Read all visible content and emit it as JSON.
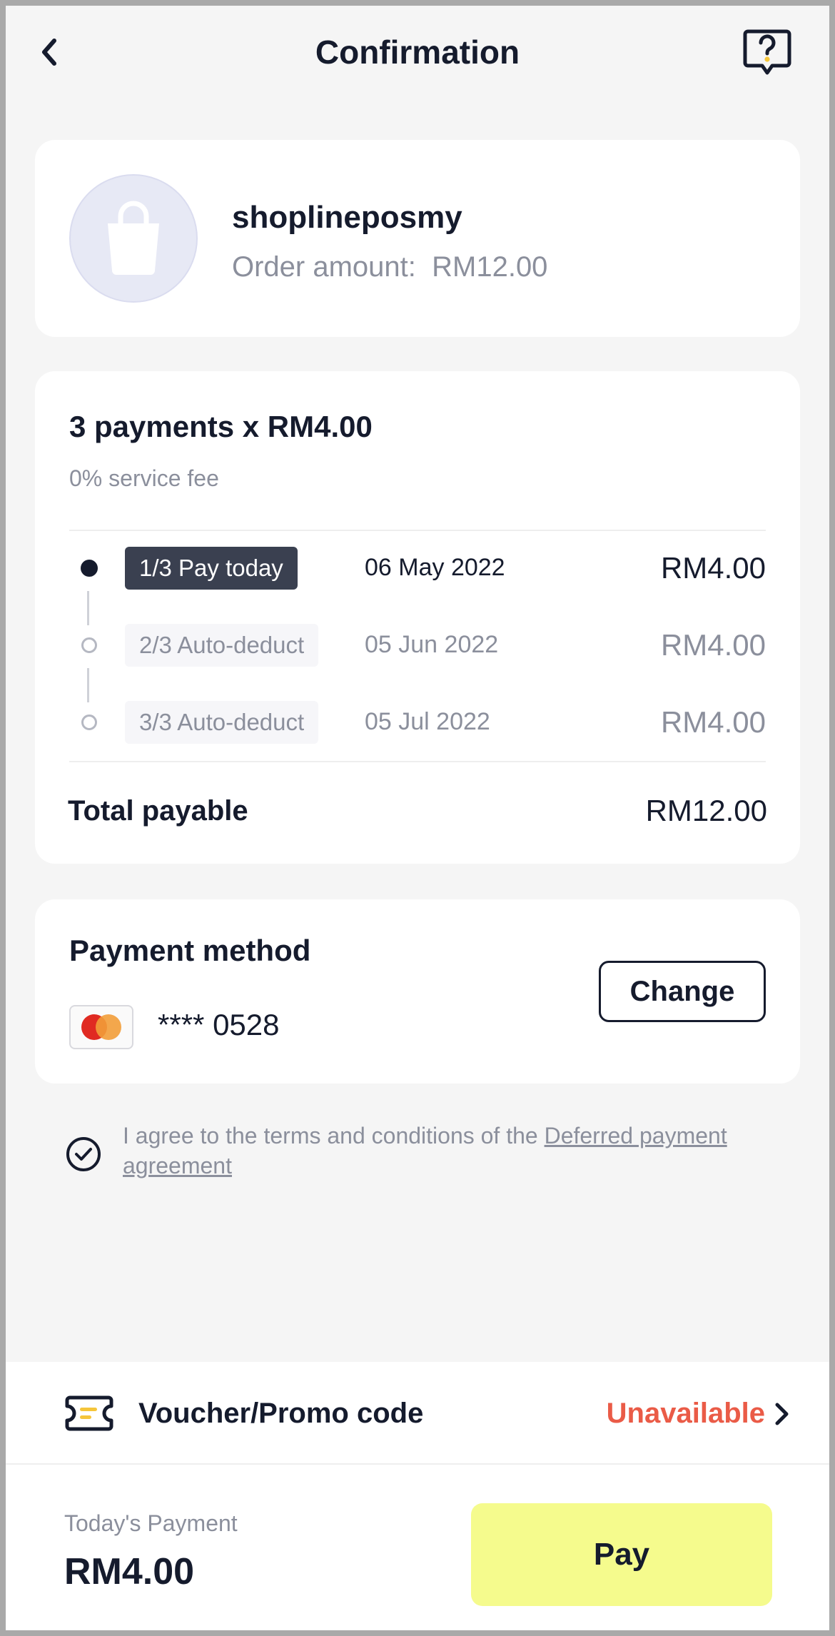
{
  "header": {
    "title": "Confirmation",
    "back_icon": "chevron-left-icon",
    "help_icon": "help-chat-icon"
  },
  "merchant": {
    "name": "shoplineposmy",
    "order_amount_label": "Order amount:",
    "order_amount": "RM12.00",
    "logo_icon": "shopping-bag-icon"
  },
  "plan": {
    "title": "3 payments x RM4.00",
    "fee": "0% service fee",
    "installments": [
      {
        "badge": "1/3 Pay today",
        "date": "06 May 2022",
        "amount": "RM4.00",
        "status": "active"
      },
      {
        "badge": "2/3 Auto-deduct",
        "date": "05 Jun 2022",
        "amount": "RM4.00",
        "status": "pending"
      },
      {
        "badge": "3/3 Auto-deduct",
        "date": "05 Jul 2022",
        "amount": "RM4.00",
        "status": "pending"
      }
    ],
    "total_label": "Total payable",
    "total_value": "RM12.00"
  },
  "payment_method": {
    "title": "Payment method",
    "card_brand_icon": "mastercard-icon",
    "card_masked": "****",
    "card_last4": "0528",
    "change_label": "Change"
  },
  "agreement": {
    "checked": true,
    "text": "I agree to the terms and conditions of the ",
    "link": "Deferred payment agreement"
  },
  "voucher": {
    "label": "Voucher/Promo code",
    "status": "Unavailable",
    "icon": "voucher-ticket-icon"
  },
  "footer": {
    "today_label": "Today's Payment",
    "today_amount": "RM4.00",
    "pay_label": "Pay"
  },
  "colors": {
    "background": "#f5f5f5",
    "card": "#ffffff",
    "text_primary": "#151b2d",
    "text_secondary": "#8b8f9c",
    "badge_active": "#3a4050",
    "unavailable": "#ea5b47",
    "pay_button": "#f5fb8d",
    "voucher_accent": "#f5c53a",
    "mastercard_red": "#e02a22",
    "mastercard_orange": "#f29d38"
  }
}
